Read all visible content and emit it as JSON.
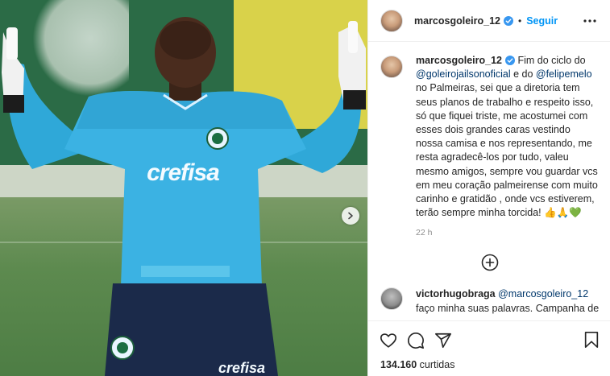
{
  "post": {
    "username": "marcosgoleiro_12",
    "follow_label": "Seguir",
    "shirt_sponsor": "crefisa",
    "shorts_sponsor": "crefisa"
  },
  "caption": {
    "username": "marcosgoleiro_12",
    "text_parts": [
      "Fim do ciclo do",
      "@goleirojailsonoficial",
      " e do ",
      "@felipemelo",
      " no Palmeiras, sei que a diretoria tem seus planos de trabalho e respeito isso, só que fiquei triste, me acostumei com esses dois grandes caras vestindo nossa camisa e nos representando, me resta agradecê-los por tudo, valeu mesmo amigos, sempre vou guardar vcs em meu coração palmeirense com muito carinho e gratidão , onde vcs estiverem, terão sempre minha torcida! 👍🙏💚"
    ],
    "time": "22 h"
  },
  "comment2": {
    "username": "victorhugobraga",
    "mention": "@marcosgoleiro_12",
    "text": "faço minha suas palavras. Campanha de"
  },
  "likes": {
    "count": "134.160",
    "label": "curtidas"
  },
  "icons": {
    "verified": "verified-badge-icon",
    "more": "more-options-icon",
    "next": "chevron-right-icon",
    "load_more": "plus-circle-icon",
    "like": "heart-icon",
    "comment": "comment-icon",
    "share": "share-icon",
    "save": "bookmark-icon"
  },
  "colors": {
    "accent": "#0095f6",
    "mention": "#00376b",
    "verified": "#3897f0",
    "muted": "#8e8e8e"
  }
}
